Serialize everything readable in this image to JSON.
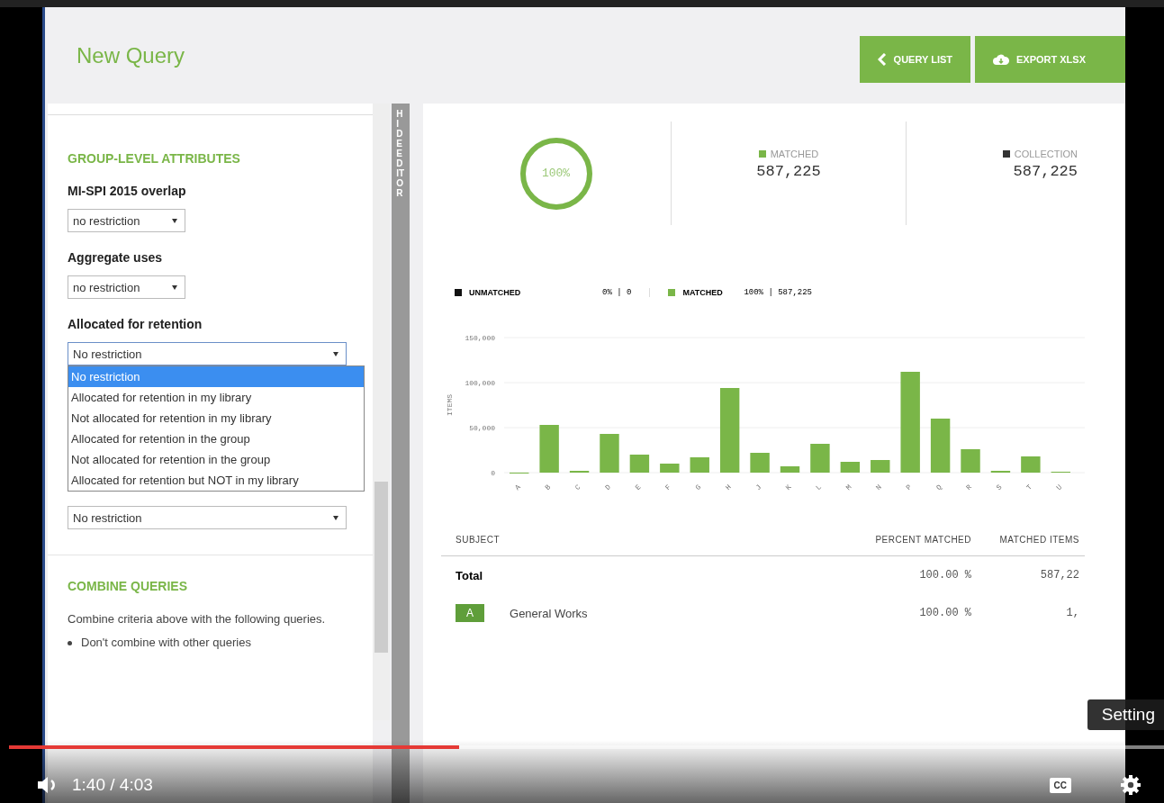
{
  "header": {
    "title": "New Query",
    "buttons": [
      {
        "kind": "back",
        "label": "QUERY LIST"
      },
      {
        "kind": "export",
        "label": "EXPORT XLSX"
      }
    ]
  },
  "editor": {
    "section_title": "GROUP-LEVEL ATTRIBUTES",
    "fields": [
      {
        "label": "MI-SPI 2015 overlap",
        "value": "no restriction",
        "kind": "small",
        "expanded": false
      },
      {
        "label": "Aggregate uses",
        "value": "no restriction",
        "kind": "small",
        "expanded": false
      },
      {
        "label": "Allocated for retention",
        "value": "No restriction",
        "kind": "wide",
        "expanded": true,
        "options": [
          {
            "label": "No restriction",
            "selected": true
          },
          {
            "label": "Allocated for retention in my library",
            "selected": false
          },
          {
            "label": "Not allocated for retention in my library",
            "selected": false
          },
          {
            "label": "Allocated for retention in the group",
            "selected": false
          },
          {
            "label": "Not allocated for retention in the group",
            "selected": false
          },
          {
            "label": "Allocated for retention but NOT in my library",
            "selected": false
          }
        ]
      },
      {
        "value": "No restriction",
        "kind": "wide",
        "expanded": false
      }
    ],
    "combine_title": "COMBINE QUERIES",
    "combine_text": "Combine criteria above with the following queries.",
    "combine_option": "Don't combine with other queries",
    "hide_tab": "HIDE EDITOR"
  },
  "stats": {
    "percent": "100%",
    "level": 1,
    "items": [
      {
        "label": "MATCHED",
        "value": "587,225",
        "color": "#7ab648"
      },
      {
        "label": "COLLECTION",
        "value": "587,225",
        "color": "#333333"
      }
    ]
  },
  "legend": [
    {
      "label": "UNMATCHED",
      "value": "0% | 0",
      "color": "#111111"
    },
    {
      "label": "MATCHED",
      "value": "100% | 587,225",
      "color": "#7ab648"
    }
  ],
  "chart_data": {
    "type": "bar",
    "ylabel": "ITEMS",
    "categories": [
      "A",
      "B",
      "C",
      "D",
      "E",
      "F",
      "G",
      "H",
      "J",
      "K",
      "L",
      "M",
      "N",
      "P",
      "Q",
      "R",
      "S",
      "T",
      "U"
    ],
    "series": [
      {
        "color": "#7ab648",
        "values": [
          0,
          53000,
          2000,
          43000,
          20000,
          10000,
          17000,
          94000,
          22000,
          7000,
          32000,
          12000,
          14000,
          112000,
          60000,
          26000,
          2000,
          18000,
          1000
        ]
      }
    ],
    "ylim": [
      0,
      150000
    ],
    "yticks": [
      {
        "value": 0,
        "label": "0"
      },
      {
        "value": 50000,
        "label": "50,000"
      },
      {
        "value": 100000,
        "label": "100,000"
      },
      {
        "value": 150000,
        "label": "150,000"
      }
    ]
  },
  "table": {
    "columns": [
      "SUBJECT",
      "PERCENT MATCHED",
      "MATCHED ITEMS"
    ],
    "rows": [
      {
        "kind": "total",
        "subject": "Total",
        "percent": "100.00 %",
        "items": "587,22"
      },
      {
        "kind": "class",
        "code": "A",
        "subject": "General Works",
        "percent": "100.00 %",
        "items": "1,"
      }
    ]
  },
  "player": {
    "time": "1:40 / 4:03",
    "level": 0.39,
    "tooltip": "Setting",
    "cc": "CC"
  }
}
